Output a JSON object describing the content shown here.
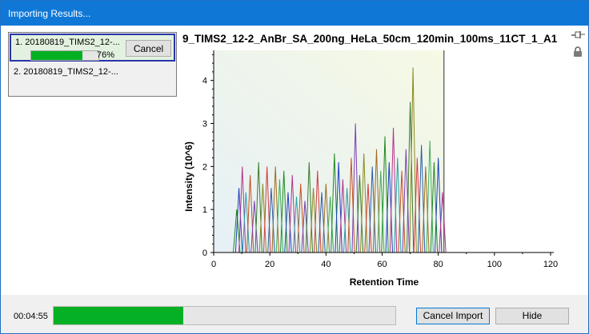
{
  "window": {
    "title": "Importing Results..."
  },
  "chart_title": "9_TIMS2_12-2_AnBr_SA_200ng_HeLa_50cm_120min_100ms_11CT_1_A1",
  "icons": {
    "pin": "pin-icon",
    "lock": "lock-icon"
  },
  "popup": {
    "item1": {
      "label": "1. 20180819_TIMS2_12-...",
      "progress": 0.76,
      "percent_label": "76%",
      "cancel_label": "Cancel"
    },
    "item2": {
      "label": "2. 20180819_TIMS2_12-..."
    }
  },
  "footer": {
    "elapsed": "00:04:55",
    "progress": 0.38,
    "cancel_import_label": "Cancel Import",
    "hide_label": "Hide"
  },
  "colors": {
    "progress_green": "#06b025",
    "title_bar": "#0f78d7"
  },
  "chart_data": {
    "type": "line",
    "xlabel": "Retention Time",
    "ylabel": "Intensity (10^6)",
    "xlim": [
      0,
      120
    ],
    "ylim": [
      0,
      4.7
    ],
    "x_ticks": [
      "0",
      "20",
      "40",
      "60",
      "80",
      "100",
      "120"
    ],
    "y_ticks": [
      "0",
      "1",
      "2",
      "3",
      "4"
    ],
    "data_range_end": 82,
    "peaks": [
      {
        "x": 8.2,
        "y": 1.0
      },
      {
        "x": 9.0,
        "y": 1.5
      },
      {
        "x": 10.2,
        "y": 2.0
      },
      {
        "x": 11.5,
        "y": 1.4
      },
      {
        "x": 13.0,
        "y": 1.8
      },
      {
        "x": 14.5,
        "y": 1.2
      },
      {
        "x": 16.0,
        "y": 2.1
      },
      {
        "x": 17.5,
        "y": 1.6
      },
      {
        "x": 19.0,
        "y": 2.0
      },
      {
        "x": 20.5,
        "y": 1.5
      },
      {
        "x": 22.0,
        "y": 2.0
      },
      {
        "x": 23.5,
        "y": 1.7
      },
      {
        "x": 25.0,
        "y": 1.9
      },
      {
        "x": 26.5,
        "y": 1.4
      },
      {
        "x": 28.0,
        "y": 1.8
      },
      {
        "x": 29.5,
        "y": 1.3
      },
      {
        "x": 31.0,
        "y": 1.6
      },
      {
        "x": 32.5,
        "y": 1.2
      },
      {
        "x": 34.0,
        "y": 2.1
      },
      {
        "x": 35.5,
        "y": 1.5
      },
      {
        "x": 37.0,
        "y": 1.9
      },
      {
        "x": 38.5,
        "y": 1.4
      },
      {
        "x": 40.0,
        "y": 1.6
      },
      {
        "x": 41.5,
        "y": 1.3
      },
      {
        "x": 43.0,
        "y": 2.3
      },
      {
        "x": 44.5,
        "y": 2.1
      },
      {
        "x": 46.0,
        "y": 1.7
      },
      {
        "x": 47.5,
        "y": 1.5
      },
      {
        "x": 49.0,
        "y": 2.2
      },
      {
        "x": 50.5,
        "y": 3.0
      },
      {
        "x": 52.0,
        "y": 1.8
      },
      {
        "x": 53.5,
        "y": 2.3
      },
      {
        "x": 55.0,
        "y": 1.6
      },
      {
        "x": 56.5,
        "y": 2.0
      },
      {
        "x": 58.0,
        "y": 2.4
      },
      {
        "x": 59.5,
        "y": 1.9
      },
      {
        "x": 61.0,
        "y": 2.7
      },
      {
        "x": 62.5,
        "y": 2.1
      },
      {
        "x": 64.0,
        "y": 2.9
      },
      {
        "x": 65.5,
        "y": 2.2
      },
      {
        "x": 67.0,
        "y": 1.9
      },
      {
        "x": 68.5,
        "y": 2.4
      },
      {
        "x": 70.0,
        "y": 3.5
      },
      {
        "x": 71.0,
        "y": 4.3
      },
      {
        "x": 72.5,
        "y": 2.2
      },
      {
        "x": 74.0,
        "y": 2.5
      },
      {
        "x": 75.5,
        "y": 2.0
      },
      {
        "x": 77.0,
        "y": 2.6
      },
      {
        "x": 78.5,
        "y": 2.1
      },
      {
        "x": 80.0,
        "y": 2.2
      },
      {
        "x": 81.5,
        "y": 1.4
      }
    ]
  }
}
